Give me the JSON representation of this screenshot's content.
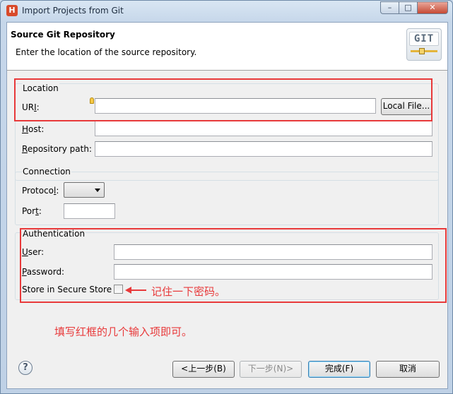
{
  "window": {
    "app_icon_glyph": "H",
    "title": "Import Projects from Git",
    "minimize_glyph": "–",
    "maximize_glyph": "□",
    "close_glyph": "✕"
  },
  "header": {
    "title": "Source Git Repository",
    "description": "Enter the location of the source repository.",
    "logo_text": "GIT"
  },
  "location": {
    "legend": "Location",
    "uri_label_pre": "UR",
    "uri_label_underlined": "I",
    "uri_label_post": ":",
    "uri_value": "",
    "local_file_button": "Local File...",
    "host_label_underlined": "H",
    "host_label_post": "ost:",
    "host_value": "",
    "repo_label_underlined": "R",
    "repo_label_post": "epository path:",
    "repo_value": ""
  },
  "connection": {
    "legend": "Connection",
    "protocol_label_pre": "Protoco",
    "protocol_label_underlined": "l",
    "protocol_label_post": ":",
    "protocol_value": "",
    "port_label_pre": "Por",
    "port_label_underlined": "t",
    "port_label_post": ":",
    "port_value": ""
  },
  "authentication": {
    "legend": "Authentication",
    "user_label_underlined": "U",
    "user_label_post": "ser:",
    "user_value": "",
    "password_label_underlined": "P",
    "password_label_post": "assword:",
    "password_value": "",
    "store_label": "Store in Secure Store",
    "store_checked": false
  },
  "annotations": {
    "checkbox_note": "记住一下密码。",
    "main_note": "填写红框的几个输入项即可。",
    "color": "#e8393a"
  },
  "footer": {
    "help_glyph": "?",
    "back_button": "<上一步(B)",
    "next_button": "下一步(N)>",
    "finish_button": "完成(F)",
    "cancel_button": "取消"
  }
}
